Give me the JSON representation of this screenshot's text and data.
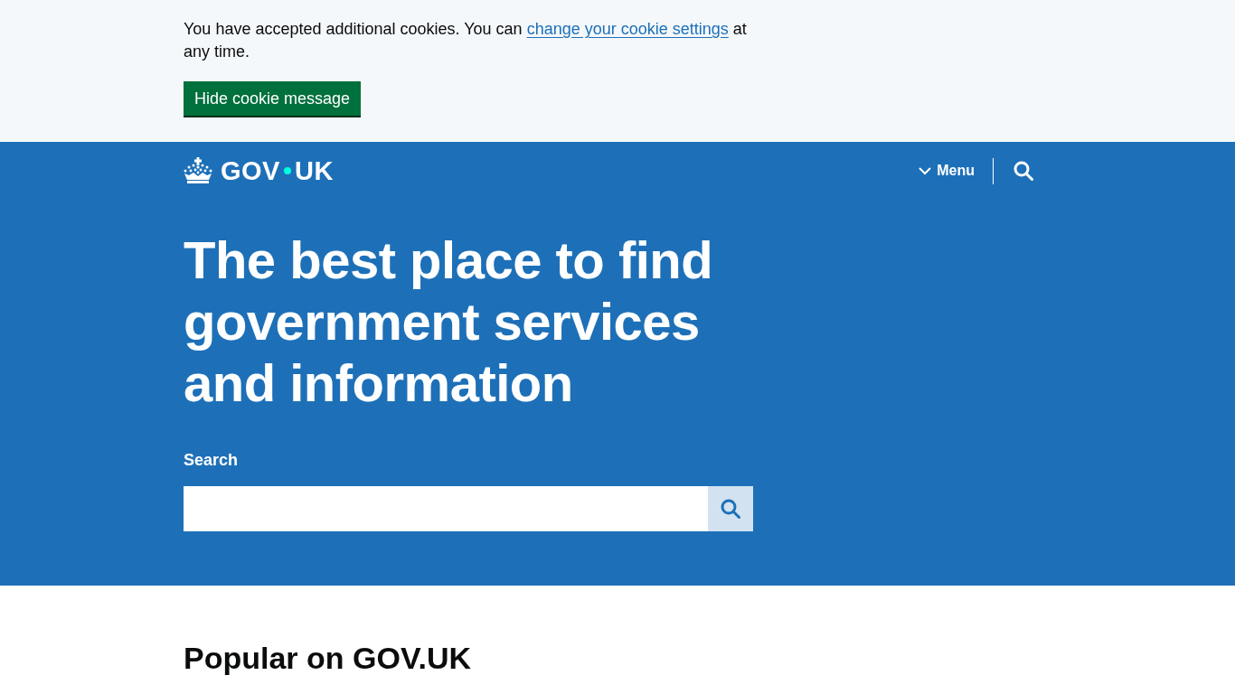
{
  "cookie_banner": {
    "message_before": "You have accepted additional cookies. You can",
    "link": "change your cookie settings",
    "message_after": "at any time.",
    "button": "Hide cookie message"
  },
  "header": {
    "logo": {
      "text_before": "GOV",
      "text_after": "UK"
    },
    "menu_button": {
      "label": "Menu",
      "expanded": false
    }
  },
  "hero": {
    "title": "The best place to find government services and information",
    "search": {
      "label": "Search"
    }
  },
  "popular": {
    "heading": "Popular on GOV.UK"
  }
}
